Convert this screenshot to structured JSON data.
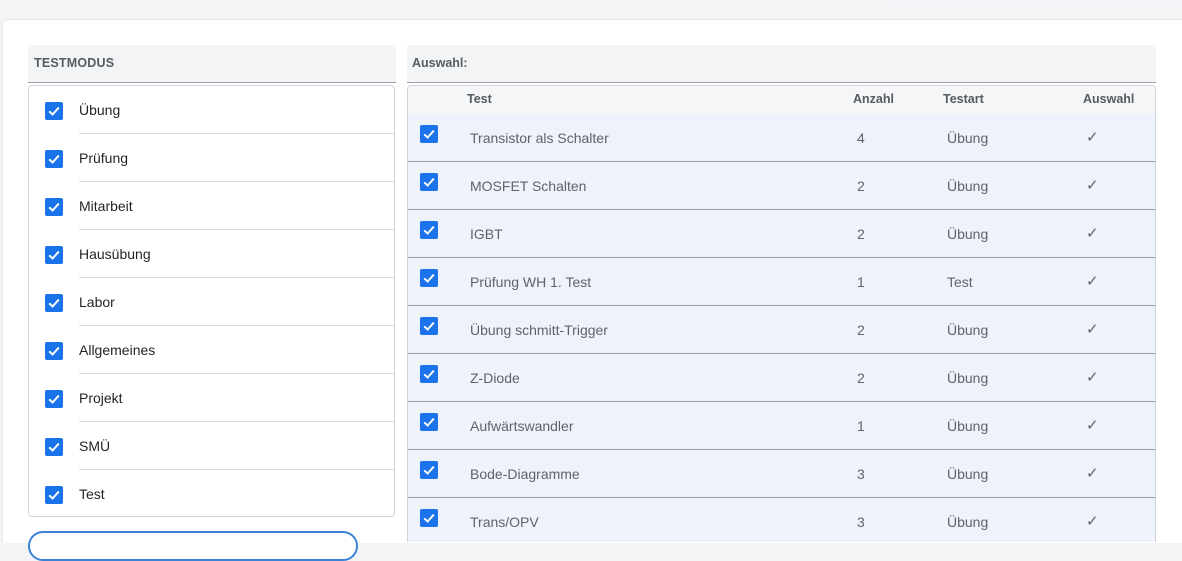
{
  "left_panel": {
    "title": "TESTMODUS",
    "items": [
      {
        "label": "Übung",
        "checked": true
      },
      {
        "label": "Prüfung",
        "checked": true
      },
      {
        "label": "Mitarbeit",
        "checked": true
      },
      {
        "label": "Hausübung",
        "checked": true
      },
      {
        "label": "Labor",
        "checked": true
      },
      {
        "label": "Allgemeines",
        "checked": true
      },
      {
        "label": "Projekt",
        "checked": true
      },
      {
        "label": "SMÜ",
        "checked": true
      },
      {
        "label": "Test",
        "checked": true
      }
    ]
  },
  "right_panel": {
    "title": "Auswahl:",
    "columns": {
      "test": "Test",
      "anzahl": "Anzahl",
      "testart": "Testart",
      "auswahl": "Auswahl"
    },
    "rows": [
      {
        "checked": true,
        "test": "Transistor als Schalter",
        "anzahl": "4",
        "testart": "Übung",
        "auswahl": "✓"
      },
      {
        "checked": true,
        "test": "MOSFET Schalten",
        "anzahl": "2",
        "testart": "Übung",
        "auswahl": "✓"
      },
      {
        "checked": true,
        "test": "IGBT",
        "anzahl": "2",
        "testart": "Übung",
        "auswahl": "✓"
      },
      {
        "checked": true,
        "test": "Prüfung WH 1. Test",
        "anzahl": "1",
        "testart": "Test",
        "auswahl": "✓"
      },
      {
        "checked": true,
        "test": "Übung schmitt-Trigger",
        "anzahl": "2",
        "testart": "Übung",
        "auswahl": "✓"
      },
      {
        "checked": true,
        "test": "Z-Diode",
        "anzahl": "2",
        "testart": "Übung",
        "auswahl": "✓"
      },
      {
        "checked": true,
        "test": "Aufwärtswandler",
        "anzahl": "1",
        "testart": "Übung",
        "auswahl": "✓"
      },
      {
        "checked": true,
        "test": "Bode-Diagramme",
        "anzahl": "3",
        "testart": "Übung",
        "auswahl": "✓"
      },
      {
        "checked": true,
        "test": "Trans/OPV",
        "anzahl": "3",
        "testart": "Übung",
        "auswahl": "✓"
      }
    ]
  },
  "colors": {
    "checkbox": "#1a73e8",
    "row_bg": "#eef3fb",
    "button_border": "#3b82d6"
  },
  "icons": {
    "checkbox": "checkbox-checked-icon",
    "check_mark": "check-mark-icon"
  }
}
